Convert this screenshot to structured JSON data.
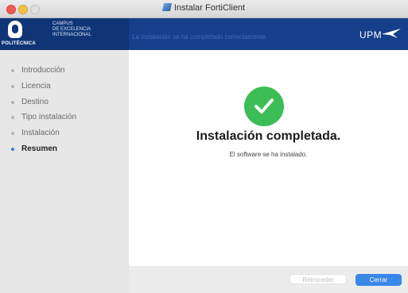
{
  "window": {
    "title": "Instalar FortiClient"
  },
  "header": {
    "logo_caption": "POLITÉCNICA",
    "campus_lines": [
      "CAMPUS",
      "DE EXCELENCIA",
      "INTERNACIONAL"
    ],
    "message": "La instalación se ha completado correctamente.",
    "brand": "UPM"
  },
  "sidebar": {
    "steps": [
      {
        "label": "Introducción"
      },
      {
        "label": "Licencia"
      },
      {
        "label": "Destino"
      },
      {
        "label": "Tipo instalación"
      },
      {
        "label": "Instalación"
      },
      {
        "label": "Resumen"
      }
    ],
    "active_step": "Resumen"
  },
  "content": {
    "headline": "Instalación completada.",
    "subline": "El software se ha instalado."
  },
  "footer": {
    "back_label": "Retroceder",
    "close_label": "Cerrar"
  },
  "colors": {
    "header_bg": "#153f8a",
    "success_green": "#3dbd56",
    "primary_button": "#3b87e8"
  }
}
